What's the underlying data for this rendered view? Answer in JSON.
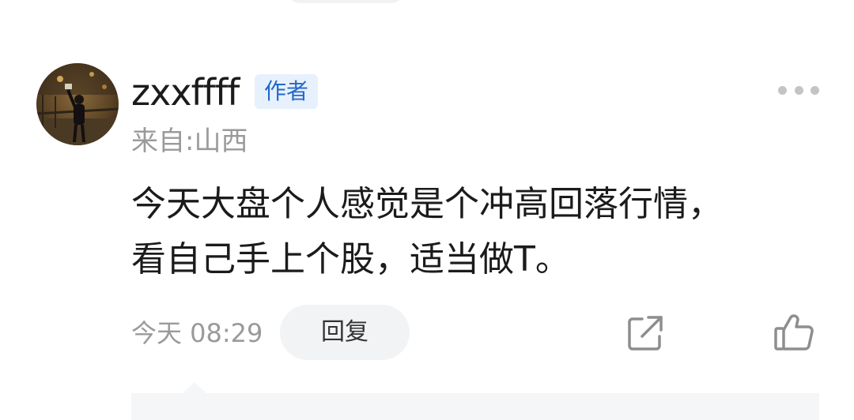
{
  "comment": {
    "username": "zxxffff",
    "badge": "作者",
    "location": "来自:山西",
    "text": "今天大盘个人感觉是个冲高回落行情，\n看自己手上个股，适当做T。",
    "time": "今天 08:29",
    "reply_label": "回复",
    "icons": {
      "more": "more-dots-icon",
      "share": "share-icon",
      "like": "thumbs-up-icon"
    }
  },
  "colors": {
    "badge_bg": "#e6f1fd",
    "badge_text": "#2468c9",
    "muted_text": "#9a9a9a",
    "primary_text": "#1b1b1b"
  }
}
